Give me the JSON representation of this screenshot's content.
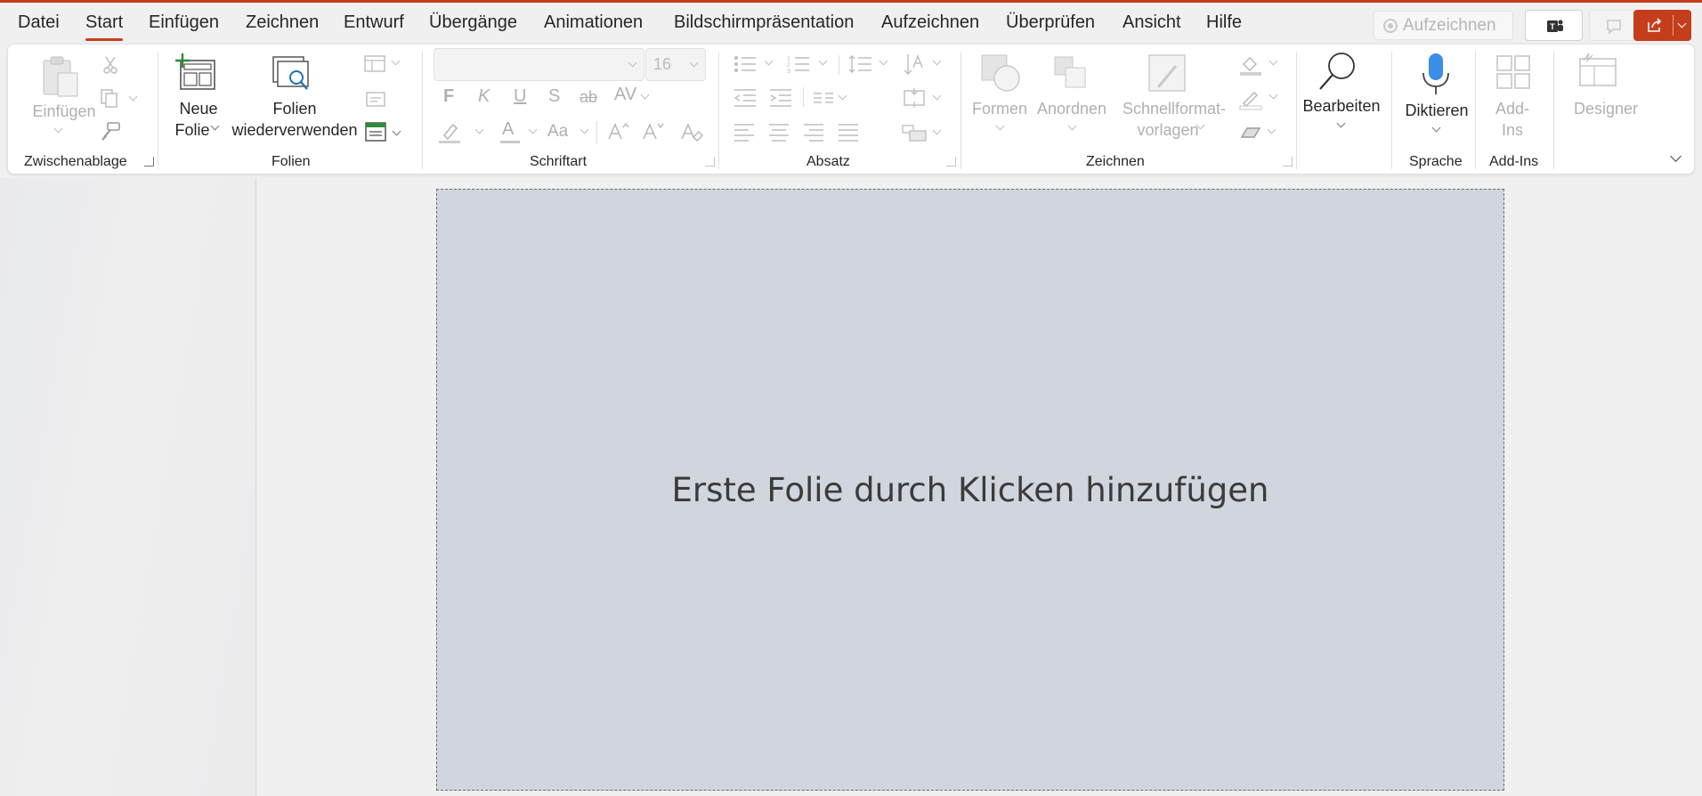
{
  "app": {
    "accent_color": "#c43e1c"
  },
  "menu": {
    "tabs": [
      "Datei",
      "Start",
      "Einfügen",
      "Zeichnen",
      "Entwurf",
      "Übergänge",
      "Animationen",
      "Bildschirmpräsentation",
      "Aufzeichnen",
      "Überprüfen",
      "Ansicht",
      "Hilfe"
    ],
    "active_tab": "Start",
    "record_button": "Aufzeichnen"
  },
  "ribbon": {
    "clipboard": {
      "group_label": "Zwischenablage",
      "paste_label": "Einfügen"
    },
    "slides": {
      "group_label": "Folien",
      "new_slide_line1": "Neue",
      "new_slide_line2": "Folie",
      "reuse_line1": "Folien",
      "reuse_line2": "wiederverwenden"
    },
    "font": {
      "group_label": "Schriftart",
      "font_name": "",
      "font_size": "16",
      "bold": "F",
      "italic": "K",
      "underline": "U",
      "shadow": "S",
      "strike": "ab",
      "spacing": "AV",
      "font_color": "A",
      "case": "Aa"
    },
    "paragraph": {
      "group_label": "Absatz"
    },
    "drawing": {
      "group_label": "Zeichnen",
      "shapes_label": "Formen",
      "arrange_label": "Anordnen",
      "quick_styles_line1": "Schnellformat-",
      "quick_styles_line2": "vorlagen"
    },
    "editing": {
      "edit_label": "Bearbeiten"
    },
    "voice": {
      "group_label": "Sprache",
      "dictate_label": "Diktieren"
    },
    "addins": {
      "group_label": "Add-Ins",
      "addins_line1": "Add-",
      "addins_line2": "Ins"
    },
    "designer": {
      "designer_label": "Designer"
    }
  },
  "slide": {
    "placeholder": "Erste Folie durch Klicken hinzufügen",
    "background_color": "#d1d5de"
  }
}
